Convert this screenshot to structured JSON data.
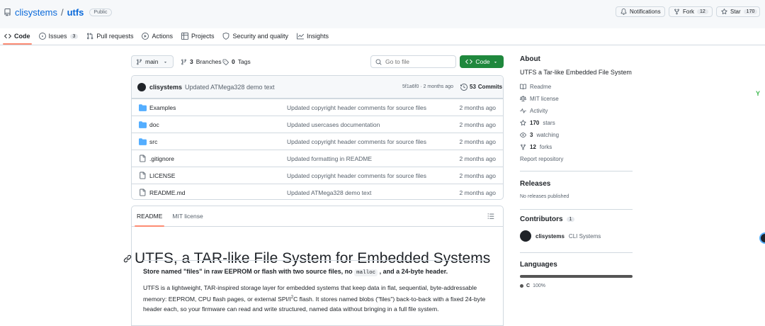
{
  "header": {
    "owner": "clisystems",
    "separator": "/",
    "repo_name": "utfs",
    "visibility": "Public",
    "notifications_label": "Notifications",
    "fork_label": "Fork",
    "fork_count": "12",
    "star_label": "Star",
    "star_count": "170"
  },
  "tabs": [
    {
      "label": "Code",
      "active": true,
      "icon": "code-icon"
    },
    {
      "label": "Issues",
      "count": "3",
      "icon": "issue-opened-icon"
    },
    {
      "label": "Pull requests",
      "icon": "git-pull-request-icon"
    },
    {
      "label": "Actions",
      "icon": "play-icon"
    },
    {
      "label": "Projects",
      "icon": "table-icon"
    },
    {
      "label": "Security and quality",
      "icon": "shield-icon"
    },
    {
      "label": "Insights",
      "icon": "graph-icon"
    }
  ],
  "toolbar": {
    "branch": "main",
    "branches_count": "3",
    "branches_label": "Branches",
    "tags_count": "0",
    "tags_label": "Tags",
    "goto_placeholder": "Go to file",
    "code_button": "Code"
  },
  "latest_commit": {
    "author": "clisystems",
    "message": "Updated ATMega328 demo text",
    "sha_time": "5f1a6f0 · 2 months ago",
    "commits_count": "53",
    "commits_label": "Commits"
  },
  "files": [
    {
      "name": "Examples",
      "type": "folder",
      "message": "Updated copyright header comments for source files",
      "time": "2 months ago"
    },
    {
      "name": "doc",
      "type": "folder",
      "message": "Updated usercases documentation",
      "time": "2 months ago"
    },
    {
      "name": "src",
      "type": "folder",
      "message": "Updated copyright header comments for source files",
      "time": "2 months ago"
    },
    {
      "name": ".gitignore",
      "type": "file",
      "message": "Updated formatting in README",
      "time": "2 months ago"
    },
    {
      "name": "LICENSE",
      "type": "file",
      "message": "Updated copyright header comments for source files",
      "time": "2 months ago"
    },
    {
      "name": "README.md",
      "type": "file",
      "message": "Updated ATMega328 demo text",
      "time": "2 months ago"
    }
  ],
  "readme": {
    "tab_readme": "README",
    "tab_license": "MIT license",
    "heading": "UTFS, a TAR-like File System for Embedded Systems",
    "lead_before": "Store named \"files\" in raw EEPROM or flash with two source files, no ",
    "lead_code": "malloc",
    "lead_after": " , and a 24-byte header.",
    "body_1": "UTFS is a lightweight, TAR-inspired storage layer for embedded systems that keep data in flat, sequential, byte-addressable memory: EEPROM, CPU flash pages, or external SPI/I",
    "body_sup": "2",
    "body_2": "C flash. It stores named blobs (\"files\") back-to-back with a fixed 24-byte header each, so your firmware can read and write structured, named data without bringing in a full file system."
  },
  "sidebar": {
    "about_title": "About",
    "description": "UTFS a Tar-like Embedded File System",
    "readme_label": "Readme",
    "license_label": "MIT license",
    "activity_label": "Activity",
    "stars_count": "170",
    "stars_label": "stars",
    "watching_count": "3",
    "watching_label": "watching",
    "forks_count": "12",
    "forks_label": "forks",
    "report_label": "Report repository",
    "releases_title": "Releases",
    "releases_text": "No releases published",
    "contributors_title": "Contributors",
    "contributors_count": "1",
    "contributor_login": "clisystems",
    "contributor_name": "CLI Systems",
    "languages_title": "Languages",
    "language_name": "C",
    "language_percent": "100%",
    "language_color": "#555555"
  },
  "edge": {
    "badge": "Y"
  },
  "colors": {
    "accent_link": "#0969da",
    "primary_button": "#1f883d",
    "tab_underline": "#fd8c73",
    "folder": "#54aeff"
  }
}
